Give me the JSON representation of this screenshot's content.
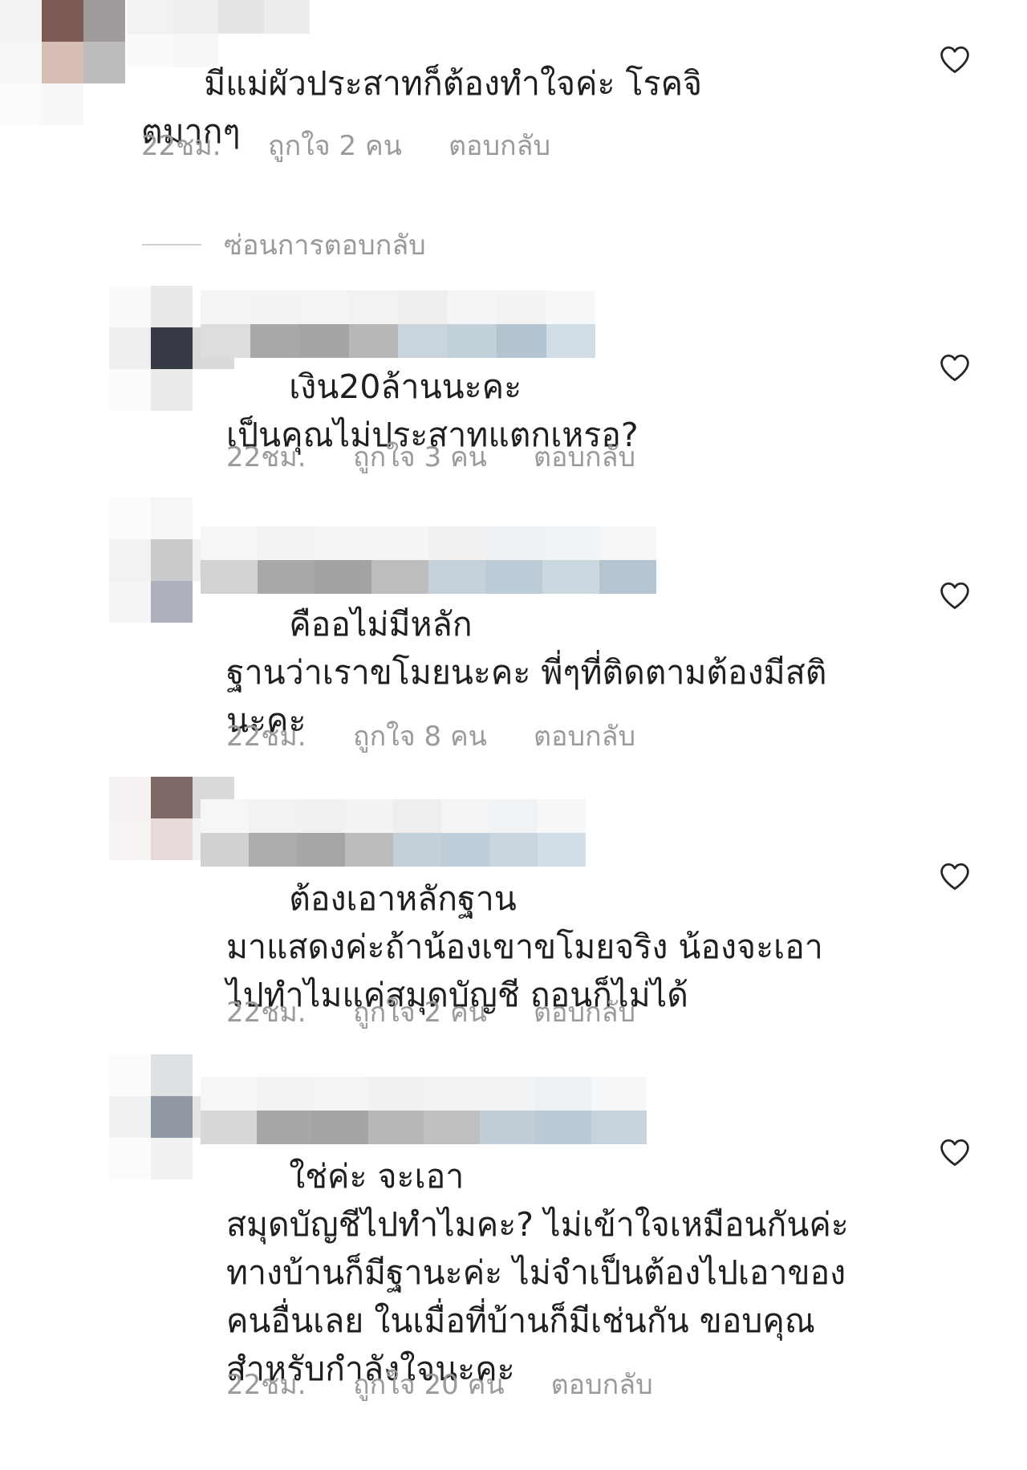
{
  "comments": [
    {
      "text_line1": "มีแม่ผัวประสาทก็ต้องทำใจค่ะ โรคจิ",
      "text_rest": "ตมากๆ",
      "time": "22ชม.",
      "likes": "ถูกใจ 2 คน",
      "reply": "ตอบกลับ"
    },
    {
      "text_line1": "เงิน20ล้านนะคะ",
      "text_rest": "เป็นคุณไม่ประสาทแตกเหรอ?",
      "time": "22ชม.",
      "likes": "ถูกใจ 3 คน",
      "reply": "ตอบกลับ"
    },
    {
      "text_line1": "คืออไม่มีหลัก",
      "text_rest": "ฐานว่าเราขโมยนะคะ พี่ๆที่ติดตามต้องมีสติ\nนะคะ",
      "time": "22ชม.",
      "likes": "ถูกใจ 8 คน",
      "reply": "ตอบกลับ"
    },
    {
      "text_line1": "ต้องเอาหลักฐาน",
      "text_rest": "มาแสดงค่ะถ้าน้องเขาขโมยจริง น้องจะเอา\nไปทำไมแค่สมุดบัญชี ถอนก็ไม่ได้",
      "time": "22ชม.",
      "likes": "ถูกใจ 2 คน",
      "reply": "ตอบกลับ"
    },
    {
      "text_line1": "ใช่ค่ะ จะเอา",
      "text_rest": "สมุดบัญชีไปทำไมคะ? ไม่เข้าใจเหมือนกันค่ะ\nทางบ้านก็มีฐานะค่ะ ไม่จำเป็นต้องไปเอาของ\nคนอื่นเลย ในเมื่อที่บ้านก็มีเช่นกัน ขอบคุณ\nสำหรับกำลังใจนะคะ",
      "time": "22ชม.",
      "likes": "ถูกใจ 20 คน",
      "reply": "ตอบกลับ"
    }
  ],
  "hide_replies_label": "ซ่อนการตอบกลับ",
  "icons": {
    "like": "heart-outline-icon"
  },
  "colors": {
    "text": "#1f1f1f",
    "meta": "#9a9a9a",
    "divider": "#cfcfcf"
  }
}
